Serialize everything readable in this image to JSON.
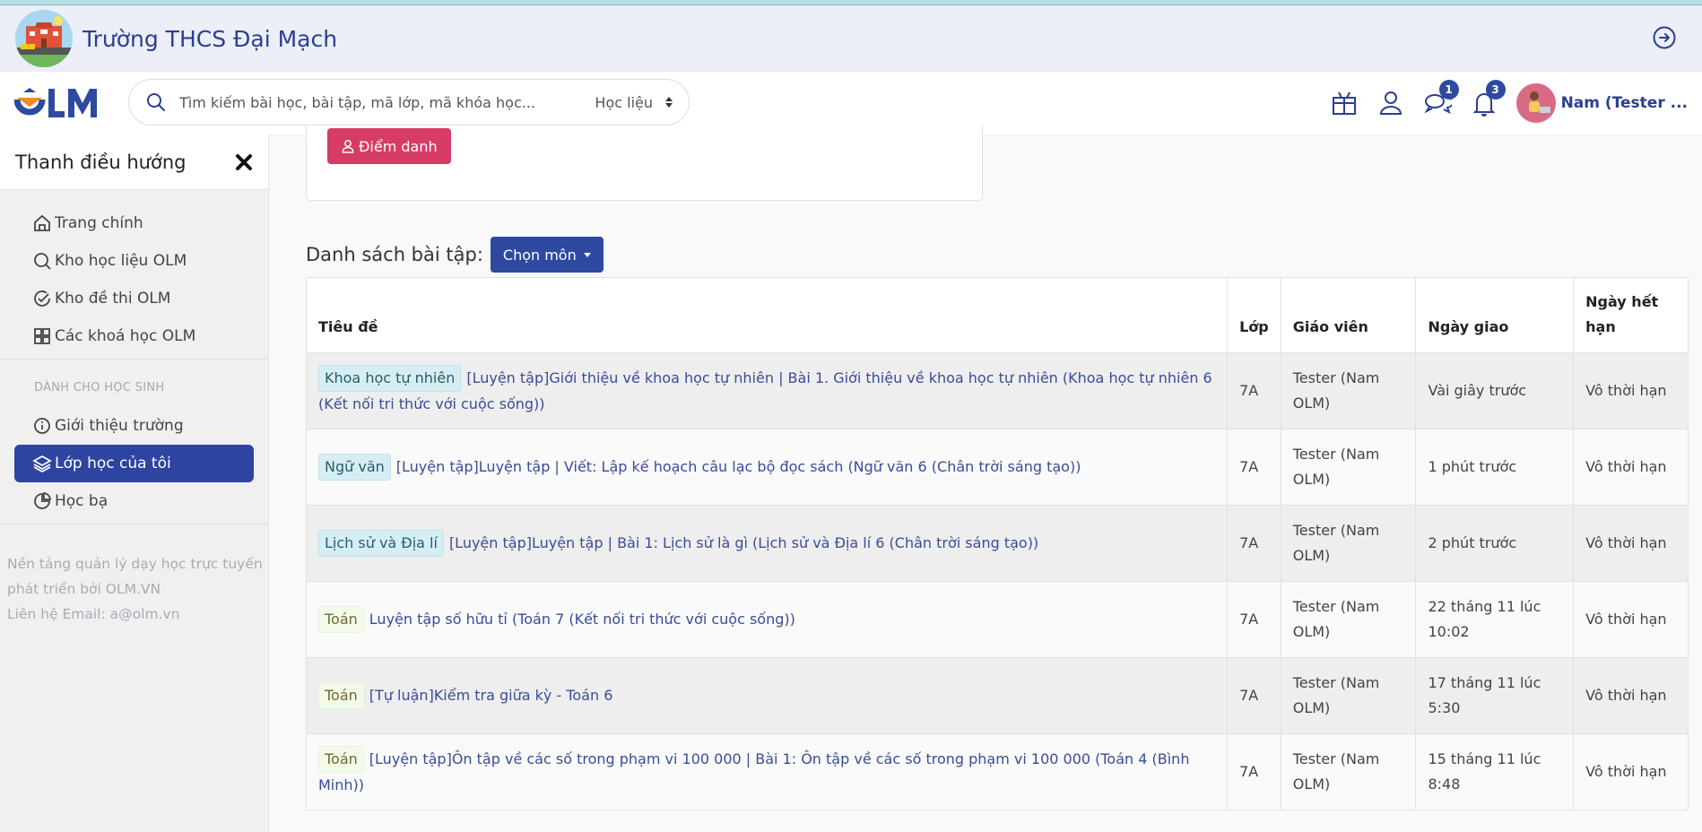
{
  "school": {
    "name": "Trường THCS Đại Mạch",
    "logo_icon": "school-building-logo",
    "exit_icon": "arrow-right-circle-icon"
  },
  "header": {
    "logo_text": "OLM",
    "search": {
      "placeholder": "Tìm kiếm bài học, bài tập, mã lớp, mã khóa học...",
      "value": "",
      "scope_selected": "Học liệu"
    },
    "icons": [
      {
        "name": "gift-icon",
        "badge": null
      },
      {
        "name": "user-icon",
        "badge": null
      },
      {
        "name": "chat-icon",
        "badge": "1"
      },
      {
        "name": "bell-icon",
        "badge": "3"
      }
    ],
    "user_name": "Nam (Tester ..."
  },
  "sidebar": {
    "title": "Thanh điều hướng",
    "items": [
      {
        "label": "Trang chính",
        "icon": "home-icon"
      },
      {
        "label": "Kho học liệu OLM",
        "icon": "search-icon"
      },
      {
        "label": "Kho đề thi OLM",
        "icon": "check-circle-icon"
      },
      {
        "label": "Các khoá học OLM",
        "icon": "grid-icon"
      }
    ],
    "section_label": "DÀNH CHO HỌC SINH",
    "student_items": [
      {
        "label": "Giới thiệu trường",
        "icon": "info-icon",
        "active": false
      },
      {
        "label": "Lớp học của tôi",
        "icon": "layers-icon",
        "active": true
      },
      {
        "label": "Học bạ",
        "icon": "pie-chart-icon",
        "active": false
      }
    ],
    "footer": {
      "line1": "Nền tảng quản lý dạy học trực tuyến",
      "line2": "phát triển bởi OLM.VN",
      "line3": "Liên hệ Email: a@olm.vn"
    }
  },
  "main": {
    "attendance_button": "Điểm danh",
    "list_title": "Danh sách bài tập:",
    "subject_button": "Chọn môn",
    "table": {
      "headers": [
        "Tiêu đề",
        "Lớp",
        "Giáo viên",
        "Ngày giao",
        "Ngày hết hạn"
      ],
      "rows": [
        {
          "subject": "Khoa học tự nhiên",
          "tag_style": "info",
          "title": "[Luyện tập]Giới thiệu về khoa học tự nhiên | Bài 1. Giới thiệu về khoa học tự nhiên (Khoa học tự nhiên 6 (Kết nối tri thức với cuộc sống))",
          "class": "7A",
          "teacher": "Tester (Nam OLM)",
          "assigned": "Vài giây trước",
          "due": "Vô thời hạn"
        },
        {
          "subject": "Ngữ văn",
          "tag_style": "info",
          "title": "[Luyện tập]Luyện tập | Viết: Lập kế hoạch câu lạc bộ đọc sách (Ngữ văn 6 (Chân trời sáng tạo))",
          "class": "7A",
          "teacher": "Tester (Nam OLM)",
          "assigned": "1 phút trước",
          "due": "Vô thời hạn"
        },
        {
          "subject": "Lịch sử và Địa lí",
          "tag_style": "info",
          "title": "[Luyện tập]Luyện tập | Bài 1: Lịch sử là gì (Lịch sử và Địa lí 6 (Chân trời sáng tạo))",
          "class": "7A",
          "teacher": "Tester (Nam OLM)",
          "assigned": "2 phút trước",
          "due": "Vô thời hạn"
        },
        {
          "subject": "Toán",
          "tag_style": "green",
          "title": "Luyện tập số hữu tỉ (Toán 7 (Kết nối tri thức với cuộc sống))",
          "class": "7A",
          "teacher": "Tester (Nam OLM)",
          "assigned": "22 tháng 11 lúc 10:02",
          "due": "Vô thời hạn"
        },
        {
          "subject": "Toán",
          "tag_style": "green",
          "title": "[Tự luận]Kiểm tra giữa kỳ - Toán 6",
          "class": "7A",
          "teacher": "Tester (Nam OLM)",
          "assigned": "17 tháng 11 lúc 5:30",
          "due": "Vô thời hạn"
        },
        {
          "subject": "Toán",
          "tag_style": "green",
          "title": "[Luyện tập]Ôn tập về các số trong phạm vi 100 000 | Bài 1: Ôn tập về các số trong phạm vi 100 000 (Toán 4 (Bình Minh))",
          "class": "7A",
          "teacher": "Tester (Nam OLM)",
          "assigned": "15 tháng 11 lúc 8:48",
          "due": "Vô thời hạn"
        }
      ]
    }
  },
  "colors": {
    "brand_blue": "#2d4aa0",
    "brand_orange": "#f08a24",
    "attendance_red": "#d63c66"
  }
}
